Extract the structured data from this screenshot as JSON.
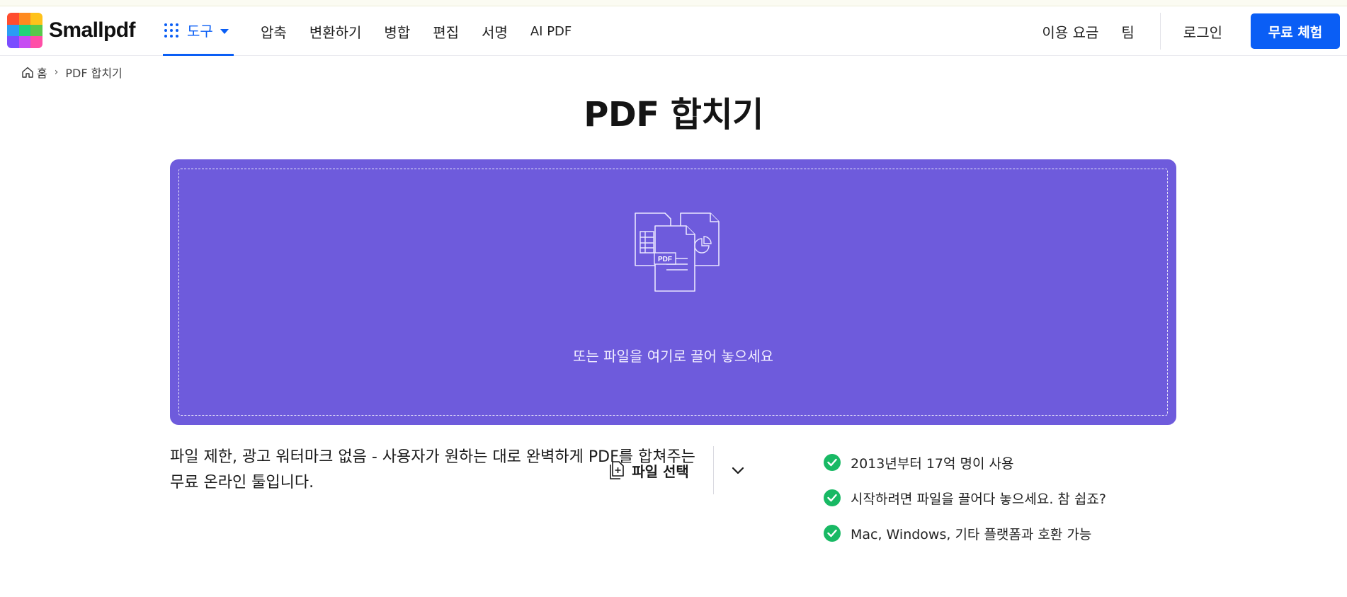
{
  "app": {
    "brand": "Smallpdf",
    "logo_colors": [
      "#ff4d2e",
      "#ff8a1f",
      "#ffc21a",
      "#2a9df4",
      "#1fd37a",
      "#58c94b",
      "#7b4dff",
      "#c64df2",
      "#ff4fa7"
    ]
  },
  "header": {
    "tools_label": "도구",
    "nav": [
      "압축",
      "변환하기",
      "병합",
      "편집",
      "서명",
      "AI PDF"
    ],
    "pricing": "이용 요금",
    "team": "팀",
    "login": "로그인",
    "trial": "무료 체험"
  },
  "breadcrumb": {
    "home": "홈",
    "current": "PDF 합치기"
  },
  "main": {
    "title": "PDF 합치기",
    "dropzone": {
      "art_label": "PDF",
      "select_button": "파일 선택",
      "hint": "또는 파일을 여기로 끌어 놓으세요"
    },
    "description_line1": "파일 제한, 광고 워터마크 없음 - 사용자가 원하는 대로 완벽하게 PDF를 합쳐주는",
    "description_line2": "무료 온라인 툴입니다.",
    "features": [
      "2013년부터 17억 명이 사용",
      "시작하려면 파일을 끌어다 놓으세요. 참 쉽죠?",
      "Mac, Windows, 기타 플랫폼과 호환 가능"
    ]
  },
  "colors": {
    "accent": "#0a5ef5",
    "dropzone": "#6e5bdc",
    "check": "#18b964"
  }
}
